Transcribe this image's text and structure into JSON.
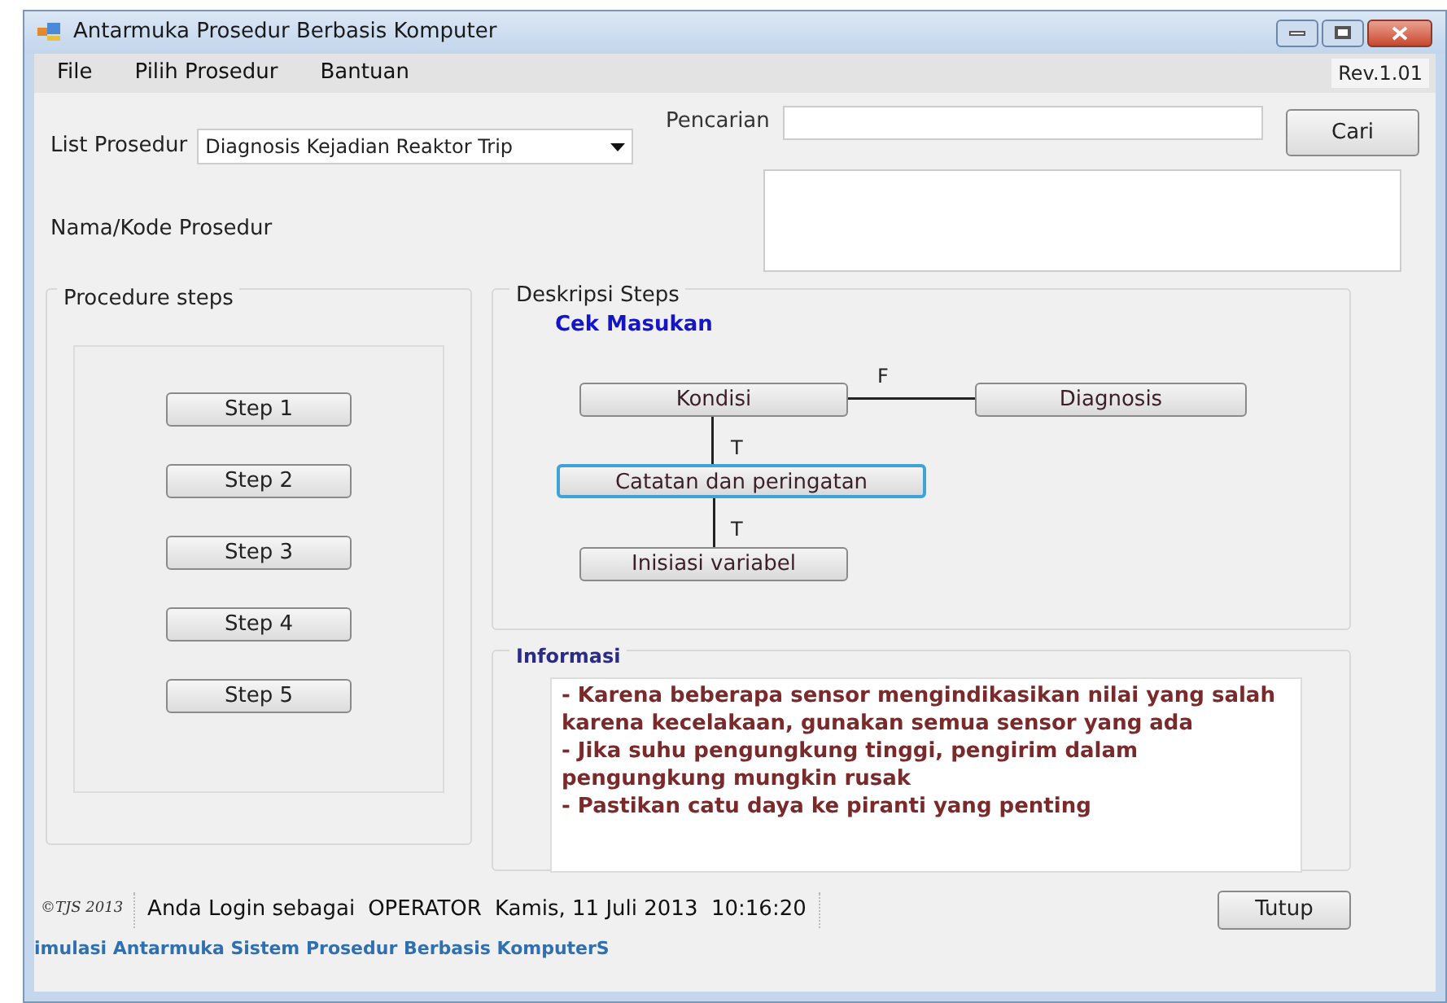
{
  "window": {
    "title": "Antarmuka Prosedur Berbasis Komputer"
  },
  "menu": [
    "File",
    "Pilih Prosedur",
    "Bantuan"
  ],
  "version": "Rev.1.01",
  "list_prosedur": {
    "label": "List Prosedur",
    "value": "Diagnosis Kejadian Reaktor Trip"
  },
  "nama_kode": {
    "label": "Nama/Kode Prosedur"
  },
  "search": {
    "label": "Pencarian",
    "button": "Cari"
  },
  "procedure_steps": {
    "title": "Procedure steps",
    "steps": [
      "Step 1",
      "Step 2",
      "Step 3",
      "Step 4",
      "Step 5"
    ]
  },
  "deskripsi": {
    "title": "Deskripsi Steps",
    "subtitle": "Cek Masukan",
    "nodes": [
      {
        "label": "Kondisi",
        "selected": false
      },
      {
        "label": "Diagnosis",
        "selected": false
      },
      {
        "label": "Catatan dan peringatan",
        "selected": true
      },
      {
        "label": "Inisiasi variabel",
        "selected": false
      }
    ],
    "edges": [
      {
        "label": "F"
      },
      {
        "label": "T"
      },
      {
        "label": "T"
      }
    ]
  },
  "informasi": {
    "title": "Informasi",
    "lines": [
      "- Karena beberapa sensor mengindikasikan nilai yang salah karena kecelakaan, gunakan semua sensor yang ada",
      "- Jika suhu pengungkung tinggi, pengirim dalam pengungkung mungkin rusak",
      "- Pastikan catu daya ke piranti yang penting"
    ]
  },
  "status": {
    "copyright": "©TJS 2013",
    "login": "Anda Login sebagai",
    "user": "OPERATOR",
    "datetime": "Kamis, 11 Juli 2013  10:16:20",
    "close_button": "Tutup"
  },
  "footer": "imulasi Antarmuka Sistem Prosedur Berbasis KomputerS"
}
